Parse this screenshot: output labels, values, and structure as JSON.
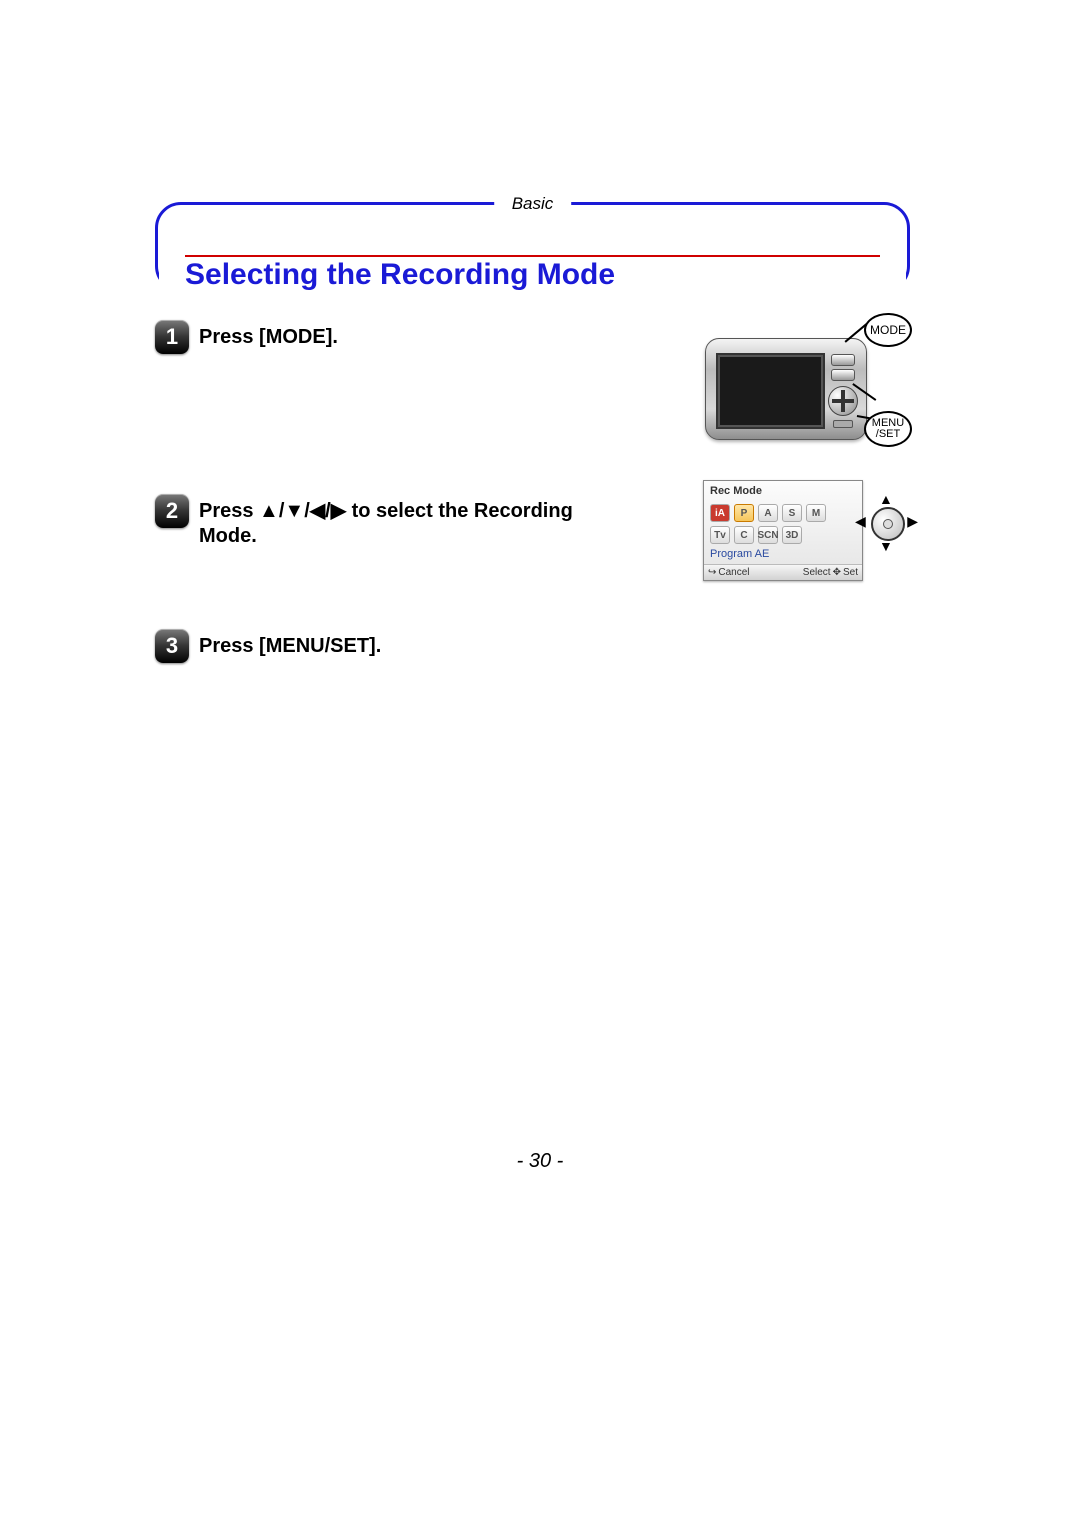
{
  "header": {
    "section_tab": "Basic",
    "title": "Selecting the Recording Mode"
  },
  "steps": [
    {
      "num": "1",
      "text": "Press [MODE]."
    },
    {
      "num": "2",
      "text": "Press ▲/▼/◀/▶ to select the Recording Mode."
    },
    {
      "num": "3",
      "text": "Press [MENU/SET]."
    }
  ],
  "camera_labels": {
    "mode": "MODE",
    "menu_line1": "MENU",
    "menu_line2": "/SET"
  },
  "mode_screen": {
    "title": "Rec Mode",
    "row1": [
      "iA",
      "P",
      "A",
      "S",
      "M"
    ],
    "row2": [
      "Tv",
      "C",
      "SCN",
      "3D"
    ],
    "subtitle": "Program AE",
    "footer_left": "Cancel",
    "footer_right_a": "Select",
    "footer_right_b": "Set"
  },
  "page_number": "- 30 -"
}
